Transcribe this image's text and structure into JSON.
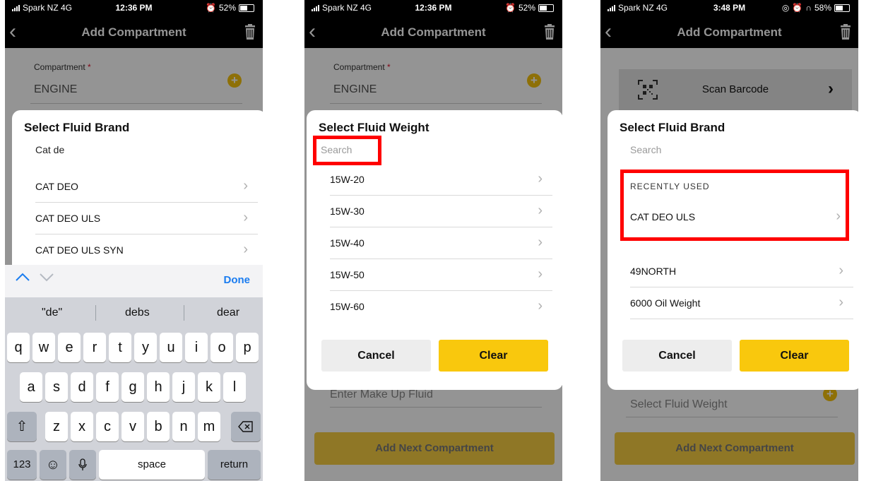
{
  "screens": [
    {
      "status": {
        "carrier": "Spark NZ  4G",
        "time": "12:36 PM",
        "battery": "52%"
      },
      "nav": {
        "back_icon": "chevron-left",
        "title": "Add Compartment",
        "delete_icon": "trash"
      },
      "compartment": {
        "label": "Compartment",
        "required_mark": "*",
        "value": "ENGINE"
      },
      "modal": {
        "title": "Select Fluid Brand",
        "search_value": "Cat de",
        "items": [
          "CAT DEO",
          "CAT DEO ULS",
          "CAT DEO ULS SYN"
        ]
      },
      "keyboard": {
        "done": "Done",
        "suggestions": [
          "\"de\"",
          "debs",
          "dear"
        ],
        "row1": [
          "q",
          "w",
          "e",
          "r",
          "t",
          "y",
          "u",
          "i",
          "o",
          "p"
        ],
        "row2": [
          "a",
          "s",
          "d",
          "f",
          "g",
          "h",
          "j",
          "k",
          "l"
        ],
        "row3": [
          "z",
          "x",
          "c",
          "v",
          "b",
          "n",
          "m"
        ],
        "numbers": "123",
        "space": "space",
        "return": "return"
      }
    },
    {
      "status": {
        "carrier": "Spark NZ  4G",
        "time": "12:36 PM",
        "battery": "52%"
      },
      "nav": {
        "back_icon": "chevron-left",
        "title": "Add Compartment",
        "delete_icon": "trash"
      },
      "compartment": {
        "label": "Compartment",
        "required_mark": "*",
        "value": "ENGINE"
      },
      "makeup_placeholder": "Enter Make Up Fluid",
      "add_next": "Add Next Compartment",
      "modal": {
        "title": "Select Fluid Weight",
        "search_placeholder": "Search",
        "items": [
          "15W-20",
          "15W-30",
          "15W-40",
          "15W-50",
          "15W-60"
        ],
        "cancel": "Cancel",
        "clear": "Clear"
      },
      "highlight_color": "#ff0000"
    },
    {
      "status": {
        "carrier": "Spark NZ  4G",
        "time": "3:48 PM",
        "battery": "58%"
      },
      "nav": {
        "back_icon": "chevron-left",
        "title": "Add Compartment",
        "delete_icon": "trash"
      },
      "scan": {
        "label": "Scan Barcode",
        "icon": "qr-code"
      },
      "fluid_weight_placeholder": "Select Fluid Weight",
      "add_next": "Add Next Compartment",
      "modal": {
        "title": "Select Fluid Brand",
        "search_placeholder": "Search",
        "recent_header": "RECENTLY USED",
        "recent_items": [
          "CAT DEO ULS"
        ],
        "items": [
          "49NORTH",
          "6000 Oil Weight"
        ],
        "cancel": "Cancel",
        "clear": "Clear"
      },
      "highlight_color": "#ff0000"
    }
  ],
  "colors": {
    "accent_yellow": "#f9c80d",
    "ios_blue": "#1a7cf0",
    "bar_black": "#000000"
  }
}
